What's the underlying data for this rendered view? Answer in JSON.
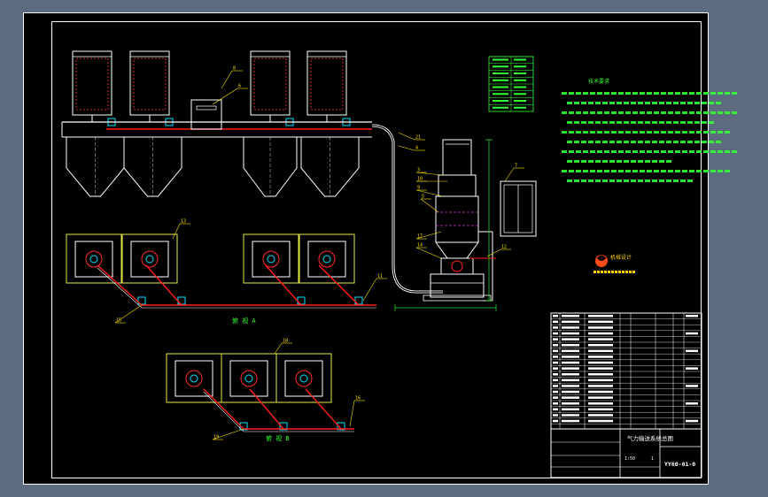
{
  "colors": {
    "background": "#5d6b7f",
    "sheet": "#000000",
    "frame": "#ffffff",
    "equipment": "#ffffff",
    "pipe": "#ff1e1e",
    "valve": "#00e0ff",
    "foundation": "#e8e84a",
    "leader": "#ffe600",
    "dim": "#2ee82e",
    "hatch": "#ff3030",
    "notes": "#34ff34",
    "binfill": "#ff3b3b",
    "dashed": "#d040d0"
  },
  "drawing": {
    "view_a_label": "俯 视 A",
    "view_b_label": "俯 视 B",
    "notes_title": "技术要求",
    "callouts": [
      "8",
      "6",
      "21",
      "4",
      "3",
      "10",
      "9",
      "7",
      "5",
      "17",
      "14",
      "12",
      "11",
      "15",
      "13",
      "18",
      "19",
      "16"
    ]
  },
  "title_block": {
    "drawing_title": "气力输送系统总图",
    "drawing_number": "YY60-01-0",
    "scale": "1:50",
    "sheet": "1"
  },
  "logo": {
    "text": "机械设计"
  }
}
